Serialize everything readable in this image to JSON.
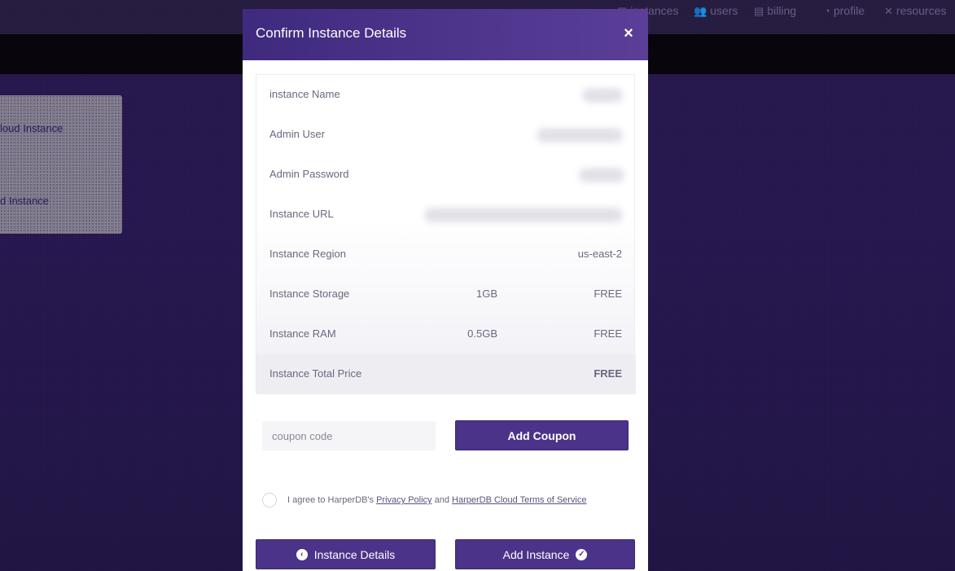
{
  "nav": {
    "items": [
      {
        "label": "instances",
        "icon": "grid-icon"
      },
      {
        "label": "users",
        "icon": "users-icon"
      },
      {
        "label": "billing",
        "icon": "billing-icon"
      },
      {
        "label": "profile",
        "icon": "user-icon"
      },
      {
        "label": "resources",
        "icon": "tools-icon"
      }
    ]
  },
  "background": {
    "card_line_1": "loud Instance",
    "card_line_2": "d Instance"
  },
  "modal": {
    "title": "Confirm Instance Details",
    "close_label": "×",
    "rows": [
      {
        "label": "instance Name",
        "mid": "",
        "value": ""
      },
      {
        "label": "Admin User",
        "mid": "",
        "value": ""
      },
      {
        "label": "Admin Password",
        "mid": "",
        "value": ""
      },
      {
        "label": "Instance URL",
        "mid": "",
        "value": ""
      },
      {
        "label": "Instance Region",
        "mid": "",
        "value": "us-east-2"
      },
      {
        "label": "Instance Storage",
        "mid": "1GB",
        "value": "FREE"
      },
      {
        "label": "Instance RAM",
        "mid": "0.5GB",
        "value": "FREE"
      },
      {
        "label": "Instance Total Price",
        "mid": "",
        "value": "FREE"
      }
    ],
    "coupon": {
      "placeholder": "coupon code",
      "button_label": "Add Coupon"
    },
    "agreement": {
      "prefix": "I agree to HarperDB's ",
      "privacy_link": "Privacy Policy",
      "middle": " and ",
      "terms_link": "HarperDB Cloud Terms of Service"
    },
    "buttons": {
      "back_label": "Instance Details",
      "add_label": "Add Instance"
    }
  },
  "colors": {
    "accent": "#4b3389",
    "header_start": "#3f2a7e",
    "header_end": "#5a3e98",
    "background": "#2b1a52"
  }
}
